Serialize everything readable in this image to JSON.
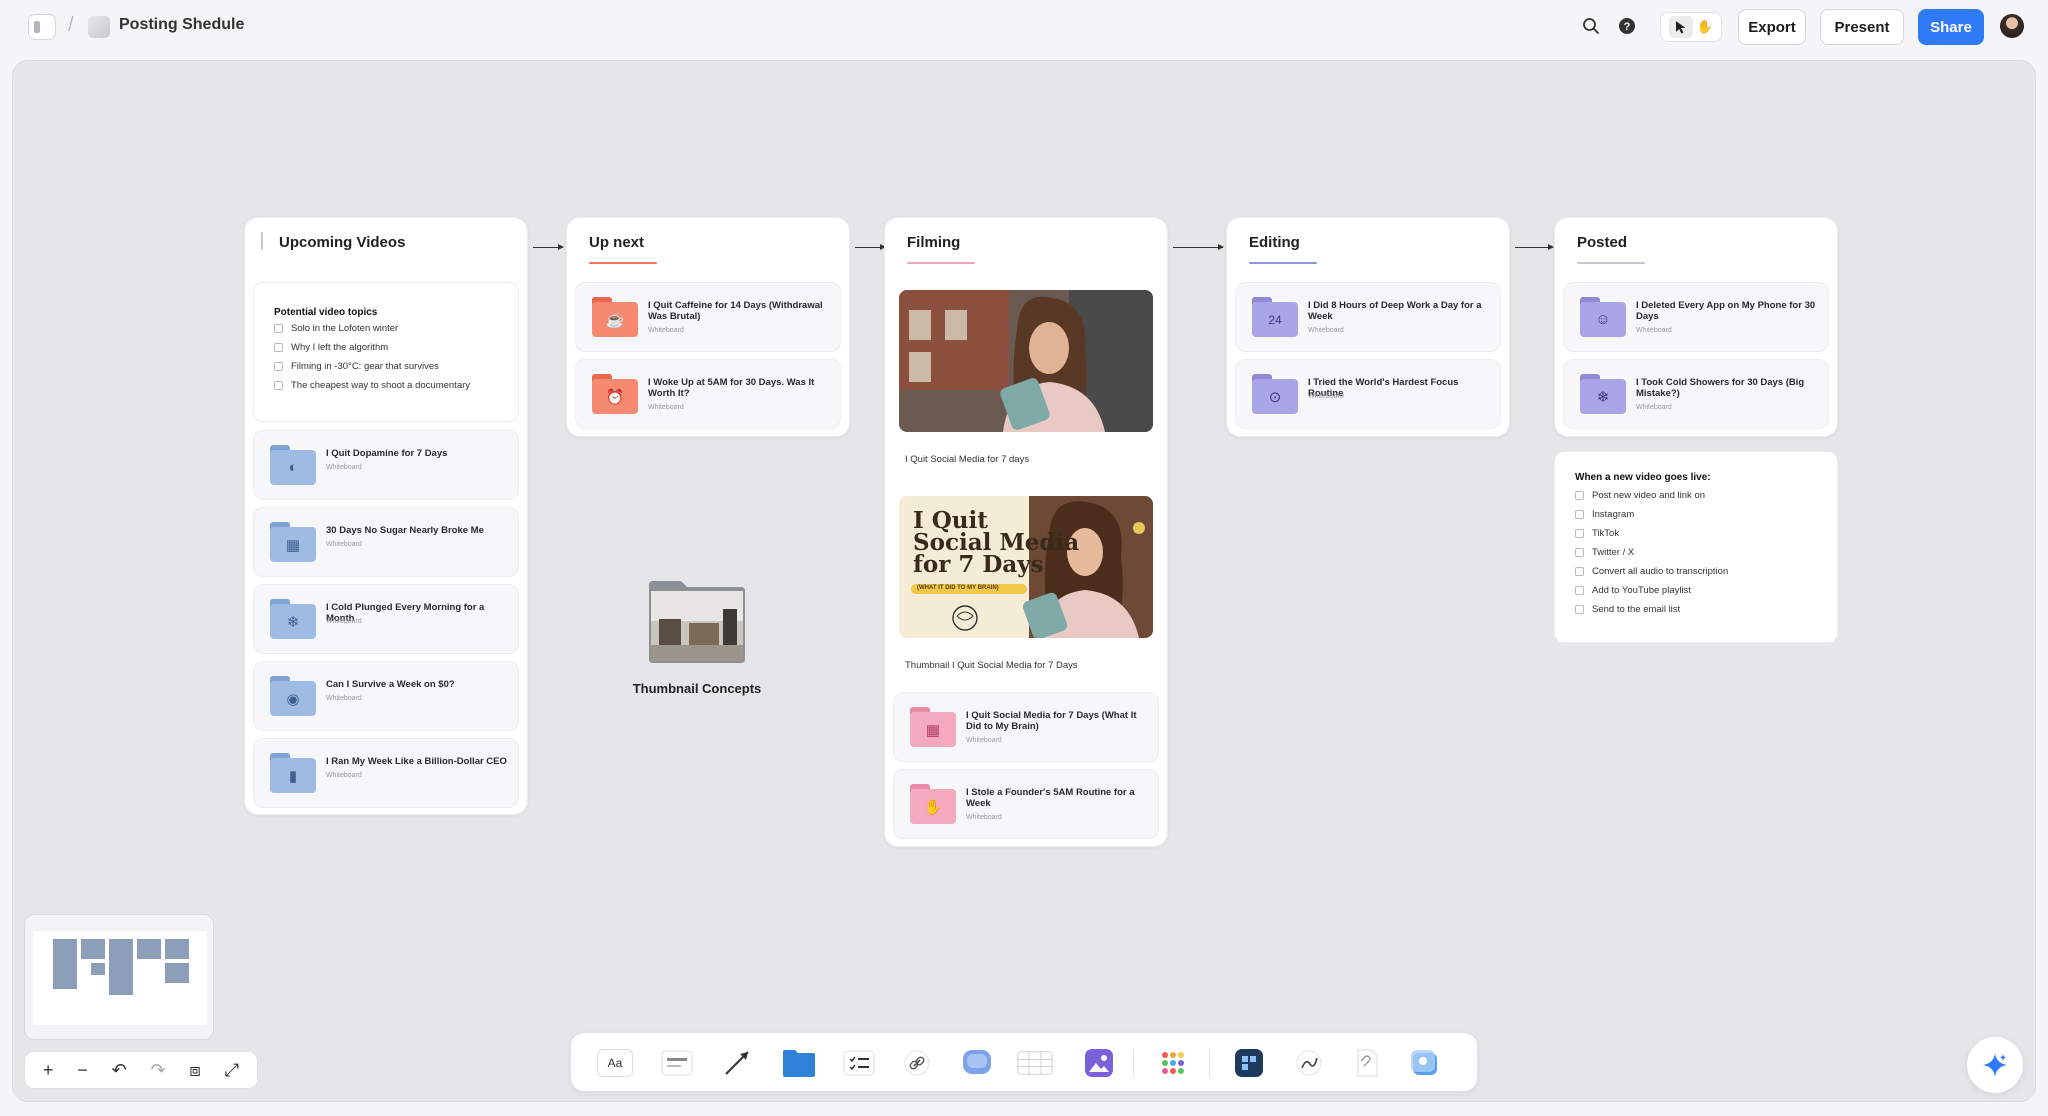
{
  "header": {
    "board_title": "Posting Shedule",
    "buttons": {
      "export": "Export",
      "present": "Present",
      "share": "Share"
    }
  },
  "colors": {
    "accent": "#2f7bf5",
    "coral": "#f0735a",
    "lavender": "#8f95e0",
    "folder_blue": "#8fb2de",
    "pink": "#f2a3bb"
  },
  "columns": {
    "upcoming": {
      "title": "Upcoming Videos",
      "checklist": {
        "title": "Potential video topics",
        "items": [
          "Solo in the Lofoten winter",
          "Why I left the algorithm",
          "Filming in -30°C: gear that survives",
          "The cheapest way to shoot a documentary"
        ]
      },
      "cards": [
        {
          "title": "I Quit Dopamine for 7 Days",
          "sub": "Whiteboard",
          "icon": "brain-icon"
        },
        {
          "title": "30 Days No Sugar Nearly Broke Me",
          "sub": "Whiteboard",
          "icon": "calendar-icon"
        },
        {
          "title": "I Cold Plunged Every Morning for a Month",
          "sub": "Whiteboard",
          "icon": "thermometer-icon"
        },
        {
          "title": "Can I Survive a Week on $0?",
          "sub": "Whiteboard",
          "icon": "money-icon"
        },
        {
          "title": "I Ran My Week Like a Billion-Dollar CEO",
          "sub": "Whiteboard",
          "icon": "phone-icon"
        }
      ]
    },
    "upnext": {
      "title": "Up next",
      "cards": [
        {
          "title": "I Quit Caffeine for 14 Days (Withdrawal Was Brutal)",
          "sub": "Whiteboard",
          "icon": "coffee-icon"
        },
        {
          "title": "I Woke Up at 5AM for 30 Days. Was It Worth It?",
          "sub": "Whiteboard",
          "icon": "alarm-icon"
        }
      ]
    },
    "filming": {
      "title": "Filming",
      "photo_caption": "I Quit Social Media for 7 days",
      "thumb_text": {
        "line1": "I Quit",
        "line2": "Social Media",
        "line3": "for 7 Days",
        "tag": "(WHAT IT DID TO MY BRAIN)"
      },
      "thumb_caption": "Thumbnail I Quit Social Media for 7 Days",
      "cards": [
        {
          "title": "I Quit Social Media for 7 Days (What It Did to My Brain)",
          "sub": "Whiteboard",
          "icon": "calendar-icon"
        },
        {
          "title": "I Stole a Founder's 5AM Routine for a Week",
          "sub": "Whiteboard",
          "icon": "briefcase-icon"
        }
      ]
    },
    "editing": {
      "title": "Editing",
      "cards": [
        {
          "title": "I Did 8 Hours of Deep Work a Day for a Week",
          "sub": "Whiteboard",
          "icon": "clock-24-icon"
        },
        {
          "title": "I Tried the World's Hardest Focus Routine",
          "sub": "Whiteboard",
          "icon": "focus-icon"
        }
      ]
    },
    "posted": {
      "title": "Posted",
      "cards": [
        {
          "title": "I Deleted Every App on My Phone for 30 Days",
          "sub": "Whiteboard",
          "icon": "head-icon"
        },
        {
          "title": "I Took Cold Showers for 30 Days (Big Mistake?)",
          "sub": "Whiteboard",
          "icon": "thermometer-icon"
        }
      ],
      "checklist": {
        "title": "When a new video goes live:",
        "items": [
          "Post new video and link on",
          "Instagram",
          "TikTok",
          "Twitter / X",
          "Convert all audio to transcription",
          "Add to YouTube playlist",
          "Send to the email list"
        ]
      }
    }
  },
  "thumbnail_folder": {
    "label": "Thumbnail Concepts"
  },
  "toolbar": {
    "text_tool": "Aa"
  }
}
